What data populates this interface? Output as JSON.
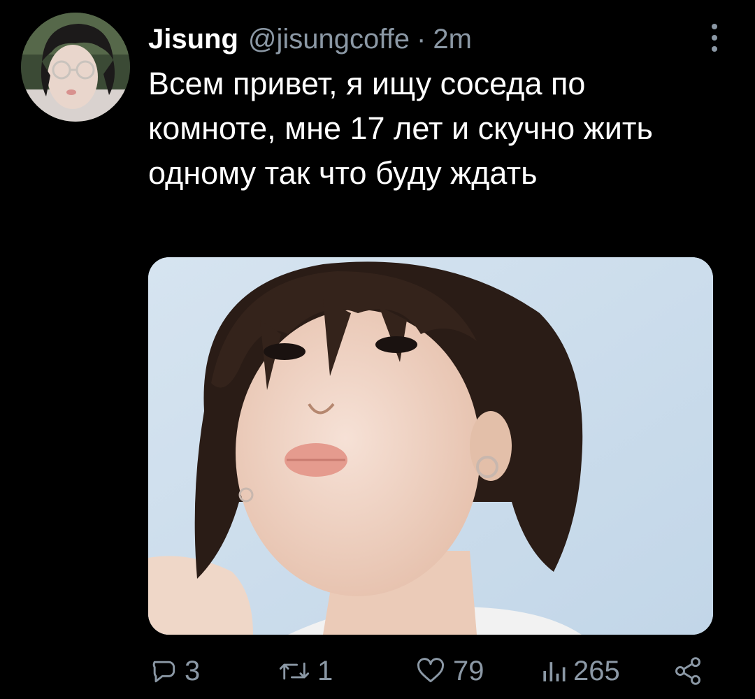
{
  "tweet": {
    "author_name": "Jisung",
    "handle": "@jisungcoffe",
    "separator": "·",
    "time": "2m",
    "text": "Всем привет, я ищу соседа по комноте, мне 17 лет и скучно жить одному так что буду ждать"
  },
  "actions": {
    "reply_count": "3",
    "retweet_count": "1",
    "like_count": "79",
    "views_count": "265"
  },
  "icons": {
    "more": "more-vertical-icon",
    "reply": "reply-icon",
    "retweet": "retweet-icon",
    "like": "heart-icon",
    "views": "views-chart-icon",
    "share": "share-icon"
  },
  "colors": {
    "background": "#000000",
    "text": "#ffffff",
    "secondary_text": "#8b98a5"
  }
}
